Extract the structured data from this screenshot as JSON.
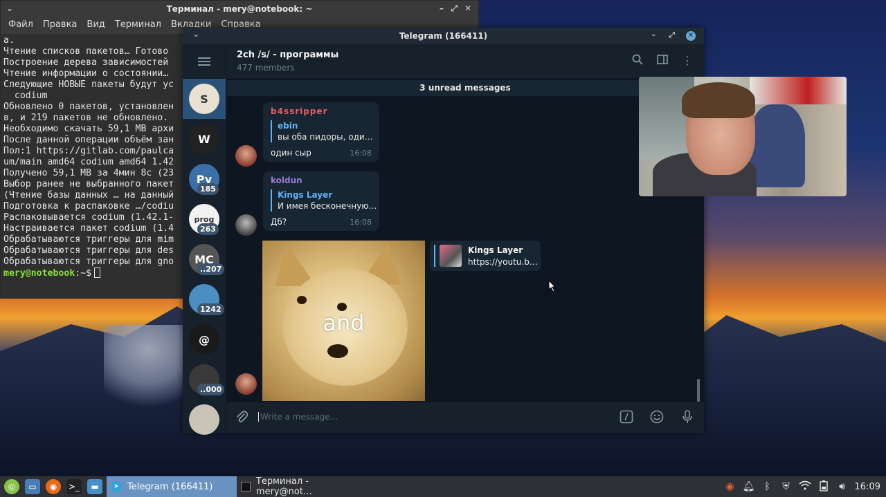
{
  "terminal": {
    "title": "Терминал - mery@notebook: ~",
    "menu": [
      "Файл",
      "Правка",
      "Вид",
      "Терминал",
      "Вкладки",
      "Справка"
    ],
    "lines": [
      "а.",
      "Чтение списков пакетов… Готово",
      "Построение дерева зависимостей",
      "Чтение информации о состоянии…",
      "Следующие НОВЫЕ пакеты будут ус",
      "  codium",
      "Обновлено 0 пакетов, установлен",
      "в, и 219 пакетов не обновлено.",
      "Необходимо скачать 59,1 MB архи",
      "После данной операции объём зан",
      "Пол:1 https://gitlab.com/paulca",
      "um/main amd64 codium amd64 1.42",
      "Получено 59,1 MB за 4мин 8c (23",
      "Выбор ранее не выбранного пакет",
      "(Чтение базы данных … на данный",
      "Подготовка к распаковке …/codiu",
      "Распаковывается codium (1.42.1-",
      "Настраивается пакет codium (1.4",
      "Обрабатываются триггеры для mim",
      "Обрабатываются триггеры для des",
      "Обрабатываются триггеры для gno"
    ],
    "prompt_user": "mery@notebook",
    "prompt_rest": ":~$"
  },
  "telegram": {
    "title": "Telegram (166411)",
    "chat": {
      "name": "2ch /s/ - программы",
      "members": "477 members",
      "unread_banner": "3 unread messages"
    },
    "sidebar_chats": [
      {
        "name": "S",
        "badge": "",
        "color": "#e8e0d0"
      },
      {
        "name": "W",
        "badge": "",
        "color": "#222222"
      },
      {
        "name": "Py",
        "badge": "185",
        "color": "#3b6fa8"
      },
      {
        "name": "prog",
        "badge": "263",
        "color": "#f2f2f2"
      },
      {
        "name": "MC",
        "badge": "..207",
        "color": "#555555"
      },
      {
        "name": "",
        "badge": "1242",
        "color": "#4a8ec2"
      },
      {
        "name": "@",
        "badge": "",
        "color": "#1a1a1a"
      },
      {
        "name": "",
        "badge": "..000",
        "color": "#3a3a3a"
      },
      {
        "name": "",
        "badge": "",
        "color": "#c9c4b8"
      }
    ],
    "messages": [
      {
        "author": "b4ssripper",
        "author_color": "#e06060",
        "reply_name": "ebin",
        "reply_text": "вы оба пидоры, оди…",
        "text": "один сыр",
        "time": "16:08"
      },
      {
        "author": "koldun",
        "author_color": "#9a7bd8",
        "reply_name": "Kings Layer",
        "reply_text": "И имея бесконечную…",
        "text": "Дб?",
        "time": "16:08"
      }
    ],
    "sticker_caption": "and",
    "link_card": {
      "name": "Kings Layer",
      "url": "https://youtu.b…"
    },
    "compose_placeholder": "Write a message...",
    "accent": "#5eb5f7"
  },
  "taskbar": {
    "tasks": [
      {
        "label": "Telegram (166411)",
        "active": true
      },
      {
        "label": "Терминал - mery@not…",
        "active": false
      }
    ],
    "clock": "16:09"
  }
}
